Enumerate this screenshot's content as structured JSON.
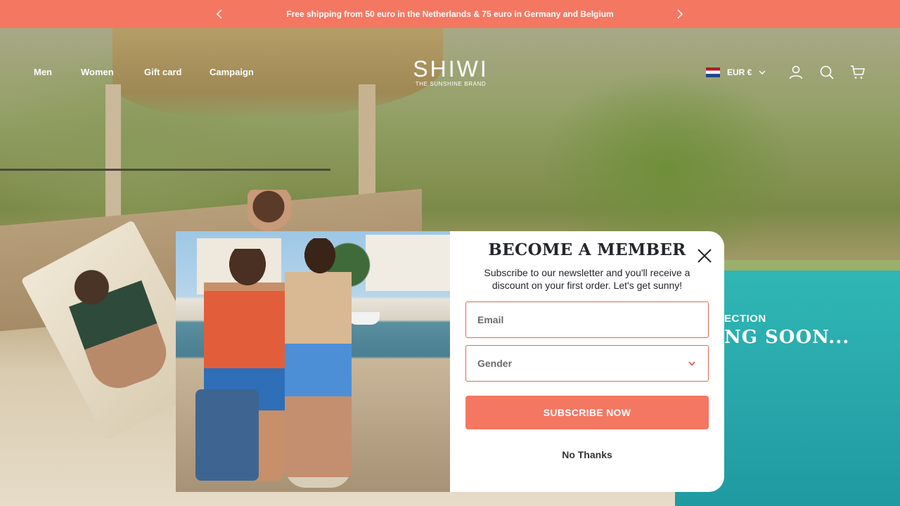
{
  "announcement": {
    "text": "Free shipping from 50 euro in the Netherlands & 75 euro in Germany and Belgium",
    "prev_icon": "chevron-left-icon",
    "next_icon": "chevron-right-icon",
    "background": "#f47762"
  },
  "header": {
    "nav": [
      "Men",
      "Women",
      "Gift card",
      "Campaign"
    ],
    "logo": {
      "word": "SHIWI",
      "tagline": "THE SUNSHINE BRAND"
    },
    "currency": {
      "flag": "netherlands-flag",
      "label": "EUR €"
    },
    "icons": [
      "account-icon",
      "search-icon",
      "cart-icon"
    ]
  },
  "hero": {
    "line1": "ECTION",
    "line2": "NG SOON..."
  },
  "popup": {
    "title": "BECOME A MEMBER",
    "description": "Subscribe to our newsletter and you'll receive a discount on your first order. Let's get sunny!",
    "email_placeholder": "Email",
    "gender_placeholder": "Gender",
    "subscribe_label": "SUBSCRIBE NOW",
    "decline_label": "No Thanks",
    "close_icon": "close-icon",
    "accent": "#f47762"
  }
}
